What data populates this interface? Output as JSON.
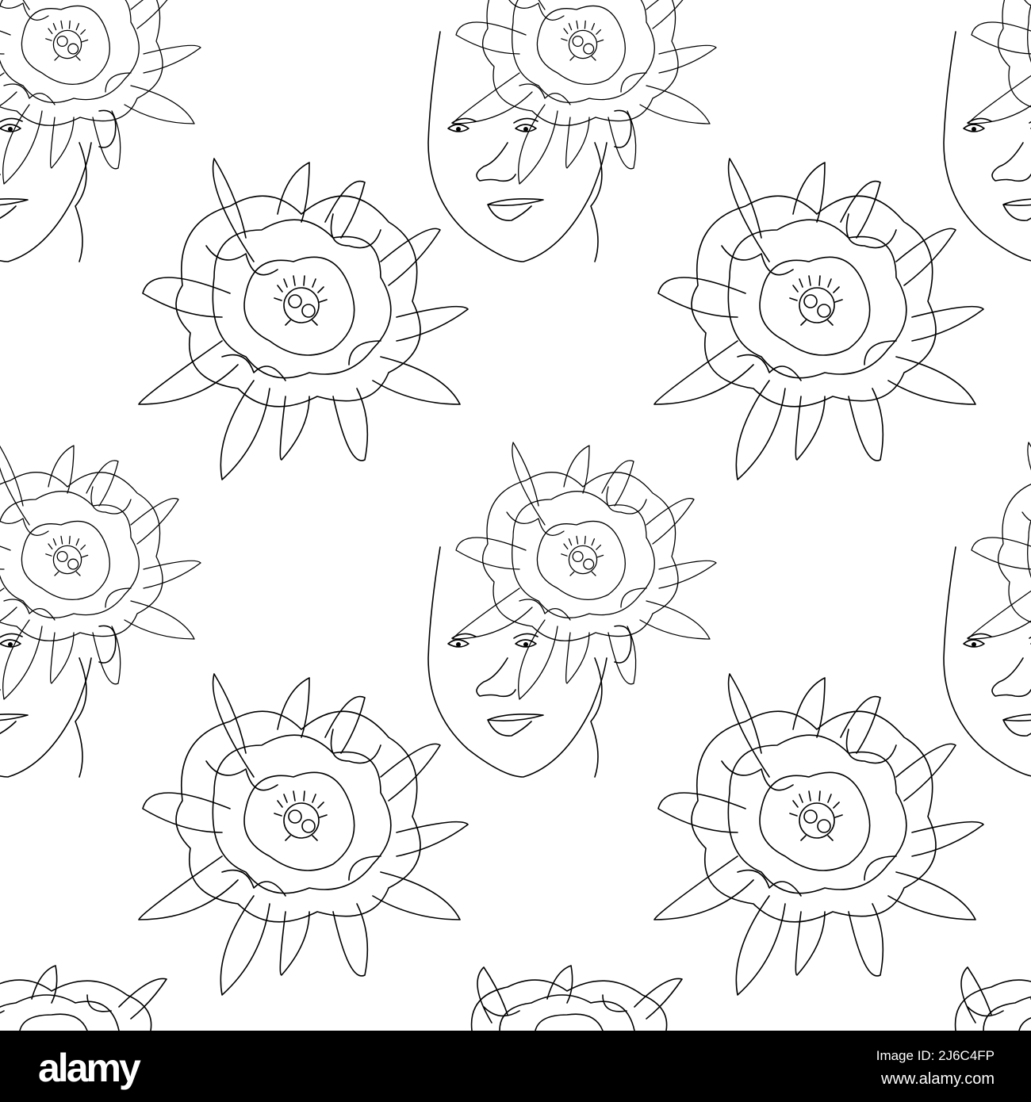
{
  "footer": {
    "logo": "alamy",
    "image_id": "Image ID: 2J6C4FP",
    "website": "www.alamy.com"
  },
  "colors": {
    "line": "#000000",
    "background": "#ffffff",
    "footer": "#000000"
  }
}
